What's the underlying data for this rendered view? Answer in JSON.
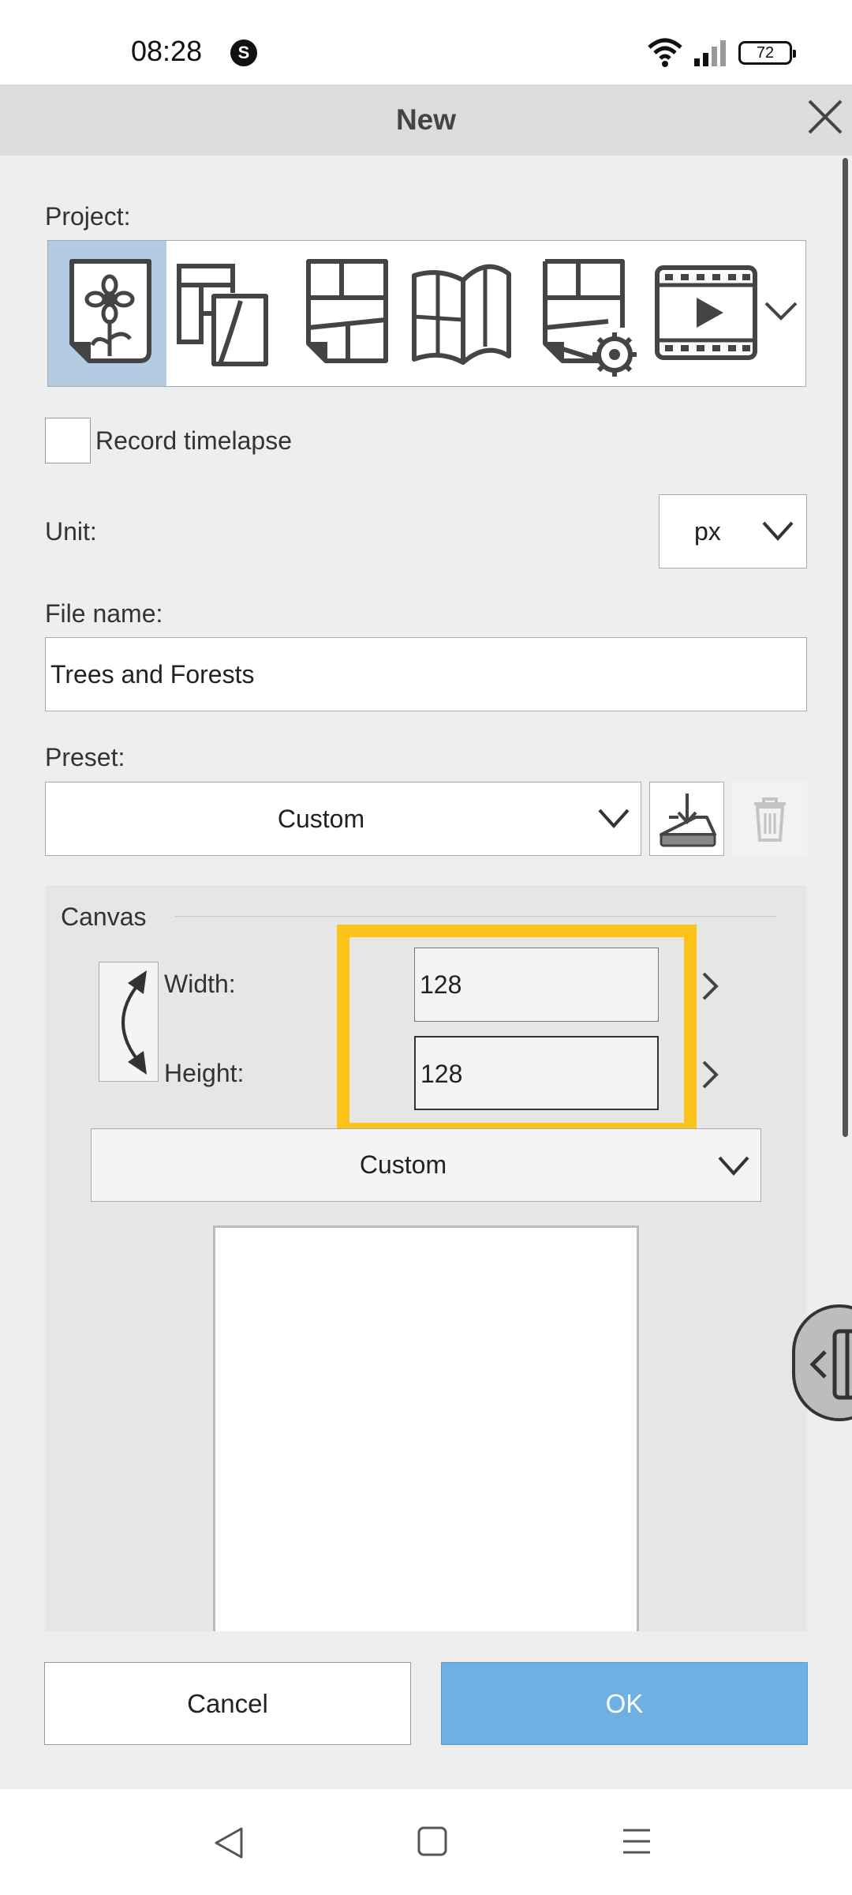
{
  "status_bar": {
    "time": "08:28",
    "app_badge": "S",
    "battery": "72"
  },
  "dialog": {
    "title": "New"
  },
  "project": {
    "label": "Project:",
    "types": [
      {
        "name": "illustration",
        "icon": "flower-page-icon",
        "selected": true
      },
      {
        "name": "comic",
        "icon": "comic-pages-icon",
        "selected": false
      },
      {
        "name": "page",
        "icon": "manga-page-icon",
        "selected": false
      },
      {
        "name": "book",
        "icon": "open-book-icon",
        "selected": false
      },
      {
        "name": "page-settings",
        "icon": "page-gear-icon",
        "selected": false
      },
      {
        "name": "animation",
        "icon": "film-play-icon",
        "selected": false
      }
    ]
  },
  "timelapse": {
    "label": "Record timelapse",
    "checked": false
  },
  "unit": {
    "label": "Unit:",
    "value": "px"
  },
  "file_name": {
    "label": "File name:",
    "value": "Trees and Forests"
  },
  "preset": {
    "label": "Preset:",
    "value": "Custom"
  },
  "canvas": {
    "section_title": "Canvas",
    "width_label": "Width:",
    "height_label": "Height:",
    "width_value": "128",
    "height_value": "128",
    "size_preset": "Custom"
  },
  "buttons": {
    "cancel": "Cancel",
    "ok": "OK"
  },
  "colors": {
    "accent": "#6fb0e4",
    "selected_project": "#b3cce4",
    "highlight": "#fcc419"
  }
}
